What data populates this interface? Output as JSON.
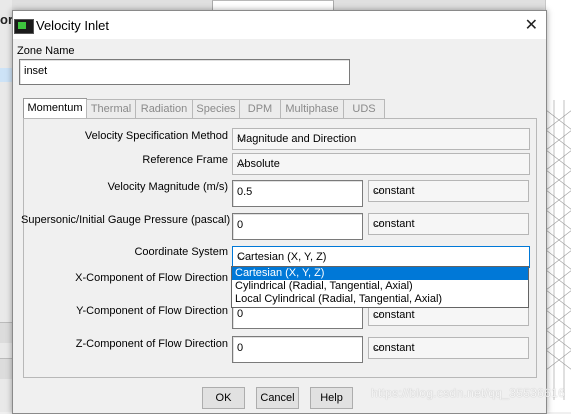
{
  "dialog": {
    "title": "Velocity Inlet"
  },
  "zone": {
    "label": "Zone Name",
    "value": "inset"
  },
  "tabs": [
    {
      "label": "Momentum",
      "active": true
    },
    {
      "label": "Thermal",
      "active": false
    },
    {
      "label": "Radiation",
      "active": false
    },
    {
      "label": "Species",
      "active": false
    },
    {
      "label": "DPM",
      "active": false
    },
    {
      "label": "Multiphase",
      "active": false
    },
    {
      "label": "UDS",
      "active": false
    }
  ],
  "momentum": {
    "velocity_spec_method": {
      "label": "Velocity Specification Method",
      "value": "Magnitude and Direction"
    },
    "reference_frame": {
      "label": "Reference Frame",
      "value": "Absolute"
    },
    "velocity_magnitude": {
      "label": "Velocity Magnitude (m/s)",
      "value": "0.5",
      "profile": "constant"
    },
    "gauge_pressure": {
      "label": "Supersonic/Initial Gauge Pressure (pascal)",
      "value": "0",
      "profile": "constant"
    },
    "coordinate_system": {
      "label": "Coordinate System",
      "value": "Cartesian (X, Y, Z)",
      "options": [
        "Cartesian (X, Y, Z)",
        "Cylindrical (Radial, Tangential, Axial)",
        "Local Cylindrical (Radial, Tangential, Axial)"
      ],
      "open": true
    },
    "x_component": {
      "label": "X-Component of Flow Direction"
    },
    "y_component": {
      "label": "Y-Component of Flow Direction",
      "value": "0",
      "profile": "constant"
    },
    "z_component": {
      "label": "Z-Component of Flow Direction",
      "value": "0",
      "profile": "constant"
    }
  },
  "buttons": {
    "ok": "OK",
    "cancel": "Cancel",
    "help": "Help"
  },
  "background": {
    "left_stub": "or"
  },
  "watermark": "https://blog.csdn.net/qq_35536616",
  "icons": {
    "app": "fluent-app-icon",
    "close": "close-icon",
    "dropdown": "chevron-down-icon"
  },
  "colors": {
    "selection": "#0078d7",
    "panel": "#f0f0f0"
  }
}
